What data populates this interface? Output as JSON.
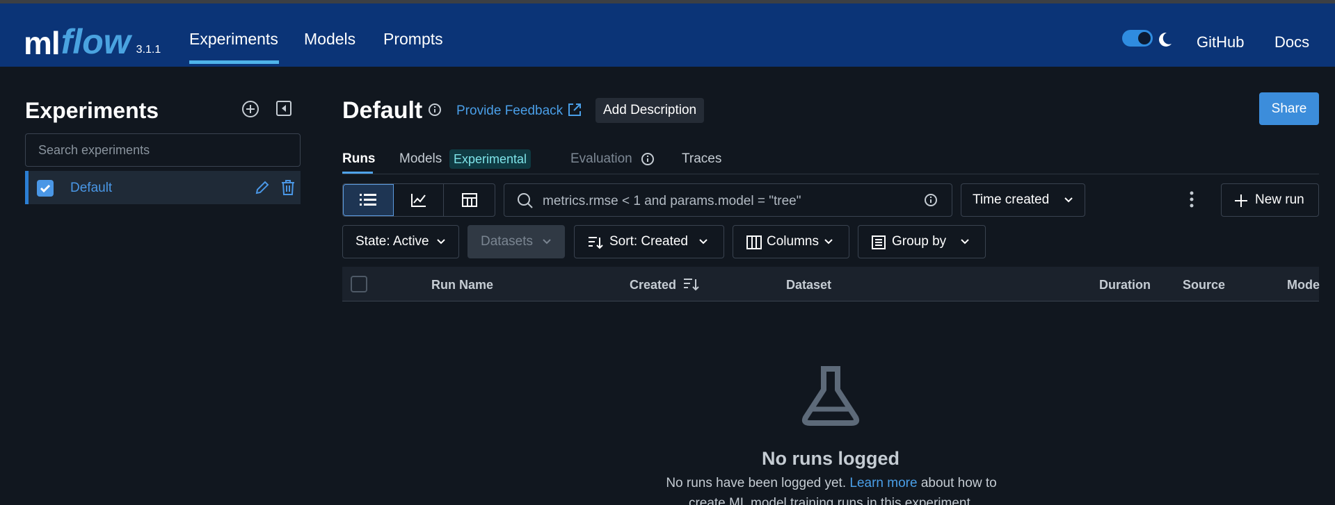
{
  "app": {
    "logo_main": "ml",
    "logo_flow": "flow",
    "version": "3.1.1"
  },
  "nav": {
    "items": [
      {
        "label": "Experiments",
        "active": true
      },
      {
        "label": "Models",
        "active": false
      },
      {
        "label": "Prompts",
        "active": false
      }
    ],
    "theme_toggle": {
      "dark_mode": true,
      "icon": "moon-icon"
    },
    "links": [
      {
        "label": "GitHub"
      },
      {
        "label": "Docs"
      }
    ]
  },
  "sidebar": {
    "title": "Experiments",
    "search_placeholder": "Search experiments",
    "items": [
      {
        "label": "Default",
        "checked": true
      }
    ]
  },
  "experiment": {
    "title": "Default",
    "feedback_label": "Provide Feedback",
    "add_description_label": "Add Description",
    "share_label": "Share"
  },
  "tabs": [
    {
      "label": "Runs",
      "active": true
    },
    {
      "label": "Models",
      "badge": "Experimental"
    },
    {
      "label": "Evaluation",
      "disabled": true
    },
    {
      "label": "Traces"
    }
  ],
  "toolbar": {
    "view_modes": [
      "list-view-icon",
      "chart-view-icon",
      "table-view-icon"
    ],
    "search_value": "metrics.rmse < 1 and params.model = \"tree\"",
    "time_filter": "Time created",
    "new_run_label": "New run",
    "state_filter": "State: Active",
    "datasets_label": "Datasets",
    "sort_label": "Sort: Created",
    "columns_label": "Columns",
    "group_by_label": "Group by"
  },
  "table": {
    "columns": [
      "Run Name",
      "Created",
      "Dataset",
      "Duration",
      "Source",
      "Mode"
    ]
  },
  "empty_state": {
    "title": "No runs logged",
    "desc_before": "No runs have been logged yet. ",
    "link": "Learn more",
    "desc_after": " about how to create ML model training runs in this experiment."
  },
  "colors": {
    "topbar": "#0b3477",
    "background": "#11171f",
    "accent": "#3c8ddb",
    "link": "#4a9fe8"
  }
}
